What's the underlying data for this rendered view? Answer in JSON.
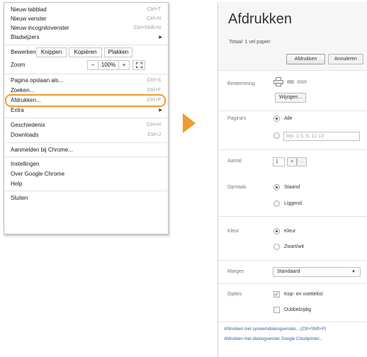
{
  "menu": {
    "items_top": [
      {
        "label": "Nieuw tabblad",
        "shortcut": "Ctrl+T"
      },
      {
        "label": "Nieuw venster",
        "shortcut": "Ctrl+N"
      },
      {
        "label": "Nieuw incognitovenster",
        "shortcut": "Ctrl+Shift+N"
      },
      {
        "label": "Bladwijzers",
        "shortcut": ""
      }
    ],
    "edit": {
      "label": "Bewerken",
      "cut": "Knippen",
      "copy": "Kopiëren",
      "paste": "Plakken"
    },
    "zoom": {
      "label": "Zoom",
      "minus": "–",
      "value": "100%",
      "plus": "+"
    },
    "items_mid": [
      {
        "label": "Pagina opslaan als...",
        "shortcut": "Ctrl+S"
      },
      {
        "label": "Zoeken...",
        "shortcut": "Ctrl+F"
      },
      {
        "label": "Afdrukken...",
        "shortcut": "Ctrl+P"
      },
      {
        "label": "Extra",
        "shortcut": ""
      }
    ],
    "items_history": [
      {
        "label": "Geschiedenis",
        "shortcut": "Ctrl+H"
      },
      {
        "label": "Downloads",
        "shortcut": "Ctrl+J"
      }
    ],
    "signin": "Aanmelden bij Chrome...",
    "items_bottom": [
      {
        "label": "Instellingen"
      },
      {
        "label": "Over Google Chrome"
      },
      {
        "label": "Help"
      }
    ],
    "exit": "Sluiten",
    "highlight_color": "#f29a2e"
  },
  "print_dialog": {
    "title": "Afdrukken",
    "total": "Totaal: 1 vel papier",
    "print_button": "Afdrukken",
    "cancel_button": "Annuleren",
    "destination_label": "Bestemming",
    "change_button": "Wijzigen...",
    "pages_label": "Pagina's",
    "pages_all": "Alle",
    "pages_placeholder": "bijv. 1-5, 8, 11-13",
    "copies_label": "Aantal",
    "copies_value": "1",
    "copies_plus": "+",
    "copies_minus": "–",
    "layout_label": "Opmaak",
    "layout_portrait": "Staand",
    "layout_landscape": "Liggend",
    "color_label": "Kleur",
    "color_color": "Kleur",
    "color_bw": "Zwart/wit",
    "margins_label": "Marges",
    "margins_value": "Standaard",
    "options_label": "Opties",
    "option_headers": "Kop- en voettekst",
    "option_duplex": "Dubbelzijdig",
    "link_system": "Afdrukken met systeemdialoogvenster... (Ctrl+Shift+P)",
    "link_cloud": "Afdrukken met dialoogvenster Google Cloudprinter..."
  },
  "icons": {
    "arrow": "orange-right-arrow-icon",
    "printer": "printer-icon",
    "submenu": "chevron-right-icon",
    "fullscreen": "fullscreen-icon",
    "dropdown": "chevron-down-icon"
  }
}
